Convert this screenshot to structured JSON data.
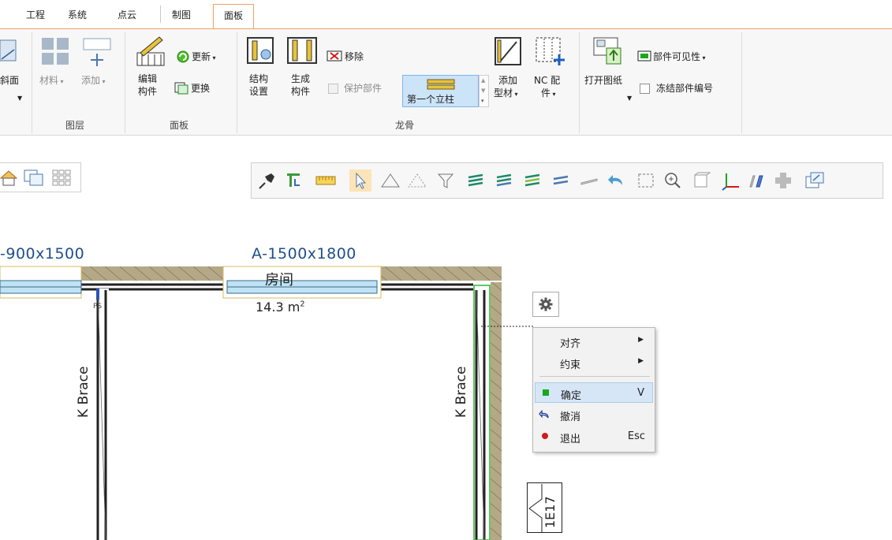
{
  "tabs": [
    "工程",
    "系统",
    "点云",
    "制图",
    "面板"
  ],
  "active_tab": "面板",
  "ribbon": {
    "partial_left_label": "斜面",
    "layer_group": {
      "label": "图层",
      "material": "材料",
      "add": "添加"
    },
    "panel_group": {
      "label": "面板",
      "edit_line1": "编辑",
      "edit_line2": "构件",
      "update": "更新",
      "replace": "更换"
    },
    "keel_group": {
      "label": "龙骨",
      "structure_line1": "结构",
      "structure_line2": "设置",
      "generate_line1": "生成",
      "generate_line2": "构件",
      "remove": "移除",
      "protect": "保护部件",
      "first_stud": "第一个立柱",
      "add_profile_line1": "添加",
      "add_profile_line2": "型材",
      "nc_line1": "NC 配",
      "nc_line2": "件"
    },
    "drawing_group": {
      "open_drawing": "打开图纸",
      "part_visibility": "部件可见性",
      "freeze_numbering": "冻结部件编号"
    }
  },
  "canvas": {
    "dimension_left": "-900x1500",
    "dimension_center": "A-1500x1800",
    "brace_left": "K Brace",
    "brace_right": "K Brace",
    "room_name": "房间",
    "room_area_value": "14.3 m",
    "room_area_unit": "2",
    "tag_label": "1E17",
    "small_label": "PS"
  },
  "context_menu": {
    "items": [
      {
        "label": "对齐",
        "submenu": true
      },
      {
        "label": "约束",
        "submenu": true
      },
      {
        "label": "确定",
        "shortcut": "V",
        "highlighted": true
      },
      {
        "label": "撤消"
      },
      {
        "label": "退出",
        "shortcut": "Esc"
      }
    ]
  },
  "colors": {
    "tab_accent": "#f1a261",
    "dimension_text": "#1f4e8c",
    "window_glass": "#bfe3f3",
    "wall_hatch": "#9a8a6a",
    "selection_green": "#2db52d",
    "confirm_green": "#1aa81a",
    "exit_red": "#d11a1a",
    "menu_highlight": "#d6e6f7"
  }
}
